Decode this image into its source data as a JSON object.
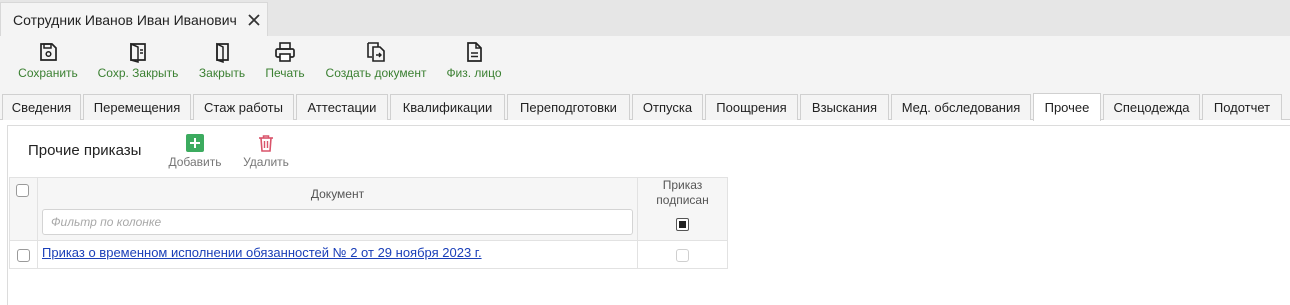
{
  "window_tab": {
    "title": "Сотрудник Иванов Иван Иванович",
    "close_icon": "close-icon"
  },
  "toolbar": {
    "save": "Сохранить",
    "save_close": "Сохр. Закрыть",
    "close": "Закрыть",
    "print": "Печать",
    "create_document": "Создать документ",
    "individual": "Физ. лицо"
  },
  "section_tabs": [
    "Сведения",
    "Перемещения",
    "Стаж работы",
    "Аттестации",
    "Квалификации",
    "Переподготовки",
    "Отпуска",
    "Поощрения",
    "Взыскания",
    "Мед. обследования",
    "Прочее",
    "Спецодежда",
    "Подотчет"
  ],
  "active_tab": "Прочее",
  "panel": {
    "title": "Прочие приказы",
    "add": "Добавить",
    "delete": "Удалить"
  },
  "grid": {
    "col_document": "Документ",
    "col_signed_line1": "Приказ",
    "col_signed_line2": "подписан",
    "filter_placeholder": "Фильтр по колонке",
    "rows": [
      {
        "document": "Приказ о временном исполнении обязанностей № 2 от 29 ноября 2023 г.",
        "signed": false
      }
    ]
  },
  "colors": {
    "accent_green": "#3b8032",
    "add_green": "#3cab5f",
    "delete_red": "#d9536a",
    "link_blue": "#1a3fb8"
  }
}
